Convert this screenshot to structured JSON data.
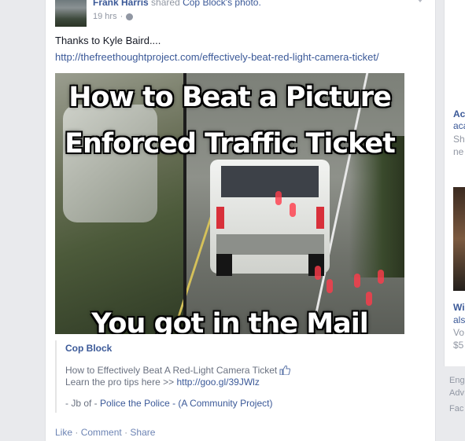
{
  "post": {
    "author": "Frank Harris",
    "shared_text": "shared",
    "shared_owner": "Cop Block",
    "shared_suffix": "'s photo.",
    "time": "19 hrs",
    "time_sep": "·",
    "text": "Thanks to Kyle Baird....",
    "link": "http://thefreethoughtproject.com/effectively-beat-red-light-camera-ticket/"
  },
  "photo": {
    "line1": "How to Beat a Picture",
    "line2": "Enforced Traffic Ticket",
    "line3": "You got in the Mail"
  },
  "quote": {
    "author": "Cop Block",
    "line1": "How to Effectively Beat A Red-Light Camera Ticket",
    "line2_prefix": "Learn the pro tips here >>",
    "line2_link": "http://goo.gl/39JWlz",
    "line3_prefix": "- Jb of -",
    "line3_link": "Police the Police - (A Community Project)"
  },
  "actions": {
    "like": "Like",
    "comment": "Comment",
    "share": "Share",
    "sep": "·"
  },
  "sidebar": {
    "ad1_title": "Ac",
    "ad1_line1": "aca",
    "ad1_line2": "Sh",
    "ad1_line3": "ne",
    "ad2_title": "Wi",
    "ad2_line1": "als",
    "ad2_line2": "Vo",
    "ad2_line3": "$5",
    "footer1": "Eng",
    "footer2": "Adv",
    "footer3": "Fac"
  },
  "colors": {
    "link": "#3b5998",
    "meta": "#9197a3",
    "background": "#e9eaed"
  },
  "icons": {
    "globe": "globe-icon",
    "like": "thumbs-up-icon",
    "caret": "chevron-down-icon"
  }
}
